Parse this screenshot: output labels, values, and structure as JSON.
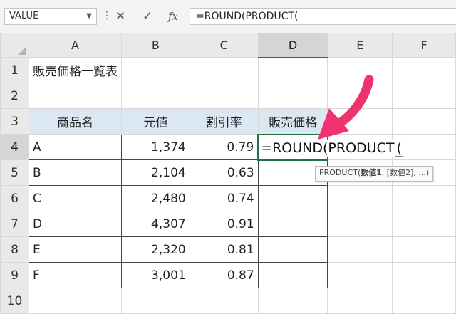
{
  "formula_bar": {
    "name_box": "VALUE",
    "name_box_arrow": "▼",
    "dots": "⋮",
    "cancel": "✕",
    "enter": "✓",
    "fx": "fx",
    "formula": "=ROUND(PRODUCT("
  },
  "columns": [
    "A",
    "B",
    "C",
    "D",
    "E",
    "F"
  ],
  "rows": [
    "1",
    "2",
    "3",
    "4",
    "5",
    "6",
    "7",
    "8",
    "9",
    "10"
  ],
  "sheet": {
    "title": "販売価格一覧表",
    "headers": [
      "商品名",
      "元値",
      "割引率",
      "販売価格"
    ],
    "data": [
      {
        "name": "A",
        "price": "1,374",
        "rate": "0.79"
      },
      {
        "name": "B",
        "price": "2,104",
        "rate": "0.63"
      },
      {
        "name": "C",
        "price": "2,480",
        "rate": "0.74"
      },
      {
        "name": "D",
        "price": "4,307",
        "rate": "0.91"
      },
      {
        "name": "E",
        "price": "2,320",
        "rate": "0.81"
      },
      {
        "name": "F",
        "price": "3,001",
        "rate": "0.87"
      }
    ],
    "active_cell_text": "=ROUND(PRODUCT",
    "active_cell_paren": "("
  },
  "tooltip": {
    "func": "PRODUCT(",
    "arg1": "数値1",
    "rest": ", [数値2], ...)"
  },
  "colors": {
    "accent": "#217346",
    "header_fill": "#dbe8f4",
    "arrow": "#f0326e"
  }
}
